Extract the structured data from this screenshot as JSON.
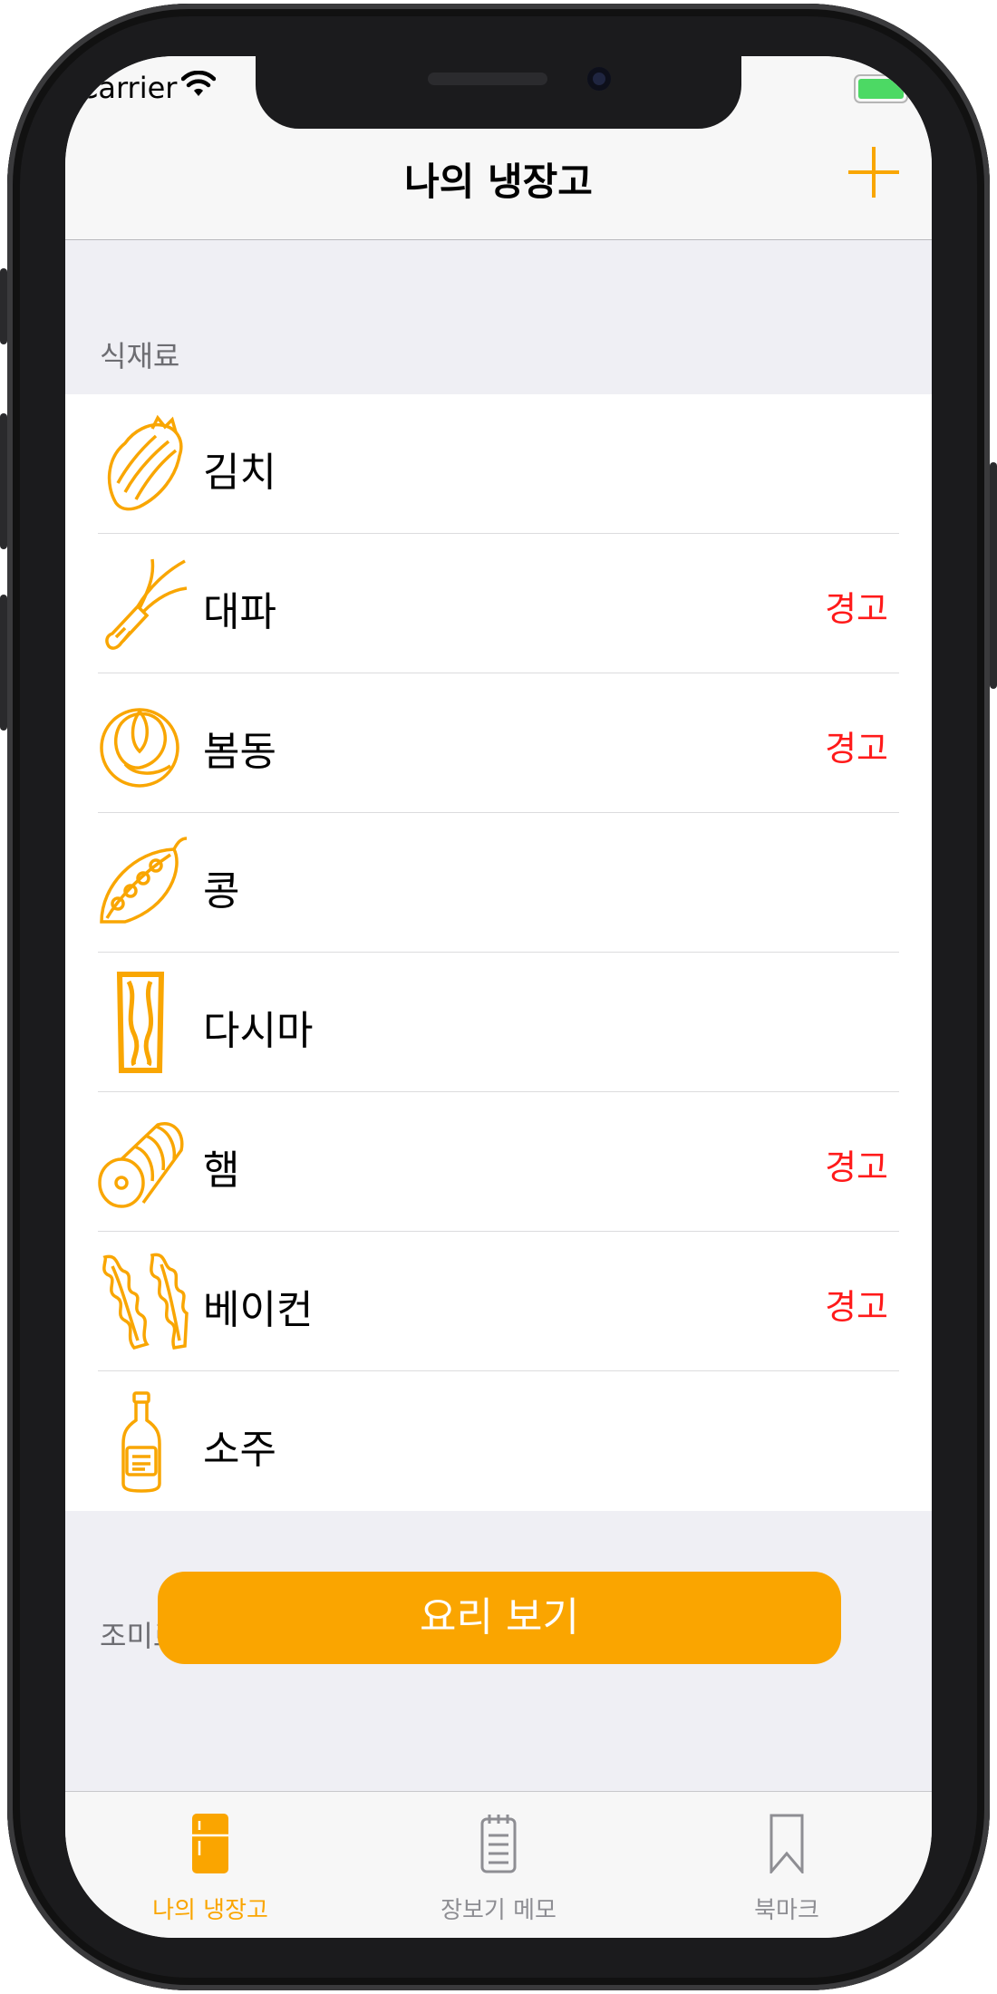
{
  "status_bar": {
    "carrier": "Carrier"
  },
  "nav": {
    "title": "나의 냉장고",
    "add_icon": "plus-icon"
  },
  "sections": [
    {
      "header": "식재료"
    },
    {
      "header": "조미료"
    }
  ],
  "ingredients": [
    {
      "name": "김치",
      "warning": "",
      "icon": "cabbage-icon"
    },
    {
      "name": "대파",
      "warning": "경고",
      "icon": "green-onion-icon"
    },
    {
      "name": "봄동",
      "warning": "경고",
      "icon": "lettuce-icon"
    },
    {
      "name": "콩",
      "warning": "",
      "icon": "pea-pod-icon"
    },
    {
      "name": "다시마",
      "warning": "",
      "icon": "kelp-icon"
    },
    {
      "name": "햄",
      "warning": "경고",
      "icon": "ham-icon"
    },
    {
      "name": "베이컨",
      "warning": "경고",
      "icon": "bacon-icon"
    },
    {
      "name": "소주",
      "warning": "",
      "icon": "bottle-icon"
    }
  ],
  "cook_button": {
    "label": "요리 보기"
  },
  "tabs": [
    {
      "label": "나의 냉장고",
      "icon": "fridge-icon",
      "selected": true
    },
    {
      "label": "장보기 메모",
      "icon": "notepad-icon",
      "selected": false
    },
    {
      "label": "북마크",
      "icon": "bookmark-icon",
      "selected": false
    }
  ],
  "colors": {
    "accent": "#faa500",
    "warning": "#ff1a1a",
    "tab_inactive": "#8e8e93"
  }
}
